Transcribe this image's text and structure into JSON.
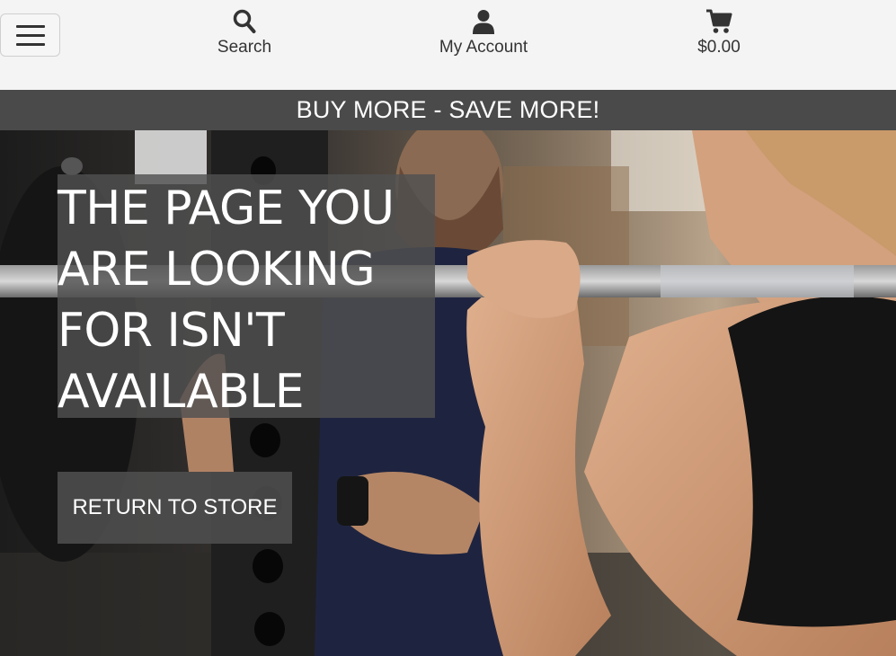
{
  "header": {
    "menu_toggle_icon": "hamburger-icon",
    "nav": [
      {
        "label": "Search",
        "icon": "search-icon"
      },
      {
        "label": "My Account",
        "icon": "user-icon"
      },
      {
        "label": "$0.00",
        "icon": "cart-icon"
      }
    ]
  },
  "banner": {
    "text": "BUY MORE - SAVE MORE!"
  },
  "hero": {
    "title_lines": [
      "THE PAGE YOU",
      "ARE LOOKING",
      "FOR ISN'T",
      "AVAILABLE"
    ],
    "button_label": "RETURN TO STORE"
  },
  "colors": {
    "banner_bg": "#4a4a4a",
    "header_bg": "#f4f4f4",
    "overlay_bg": "#505050",
    "text_dark": "#333333"
  }
}
